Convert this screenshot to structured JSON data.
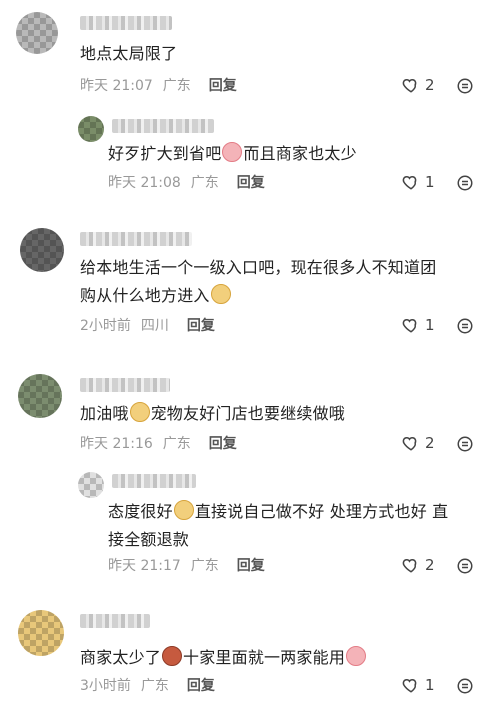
{
  "comments": [
    {
      "text": "地点太局限了",
      "time": "昨天 21:07",
      "location": "广东",
      "reply": "回复",
      "likes": "2"
    },
    {
      "text": "好歹扩大到省吧",
      "text2": "而且商家也太少",
      "emoji": "crying-emoji",
      "time": "昨天 21:08",
      "location": "广东",
      "reply": "回复",
      "likes": "1"
    },
    {
      "text": "给本地生活一个一级入口吧，现在很多人不知道团",
      "text_line2": "购从什么地方进入",
      "emoji": "dog-emoji",
      "time": "2小时前",
      "location": "四川",
      "reply": "回复",
      "likes": "1"
    },
    {
      "text": "加油哦",
      "text2": "宠物友好门店也要继续做哦",
      "emoji": "dog-emoji",
      "time": "昨天 21:16",
      "location": "广东",
      "reply": "回复",
      "likes": "2"
    },
    {
      "text": "态度很好",
      "text2": "直接说自己做不好 处理方式也好 直",
      "text_line2": "接全额退款",
      "emoji": "dog-emoji",
      "time": "昨天 21:17",
      "location": "广东",
      "reply": "回复",
      "likes": "2"
    },
    {
      "text": "商家太少了",
      "text2": "十家里面就一两家能用",
      "emoji1": "girl-emoji",
      "emoji2": "crying-emoji",
      "time": "3小时前",
      "location": "广东",
      "reply": "回复",
      "likes": "1"
    }
  ],
  "colors": {
    "meta": "#999999",
    "text": "#222222",
    "background": "#ffffff"
  }
}
